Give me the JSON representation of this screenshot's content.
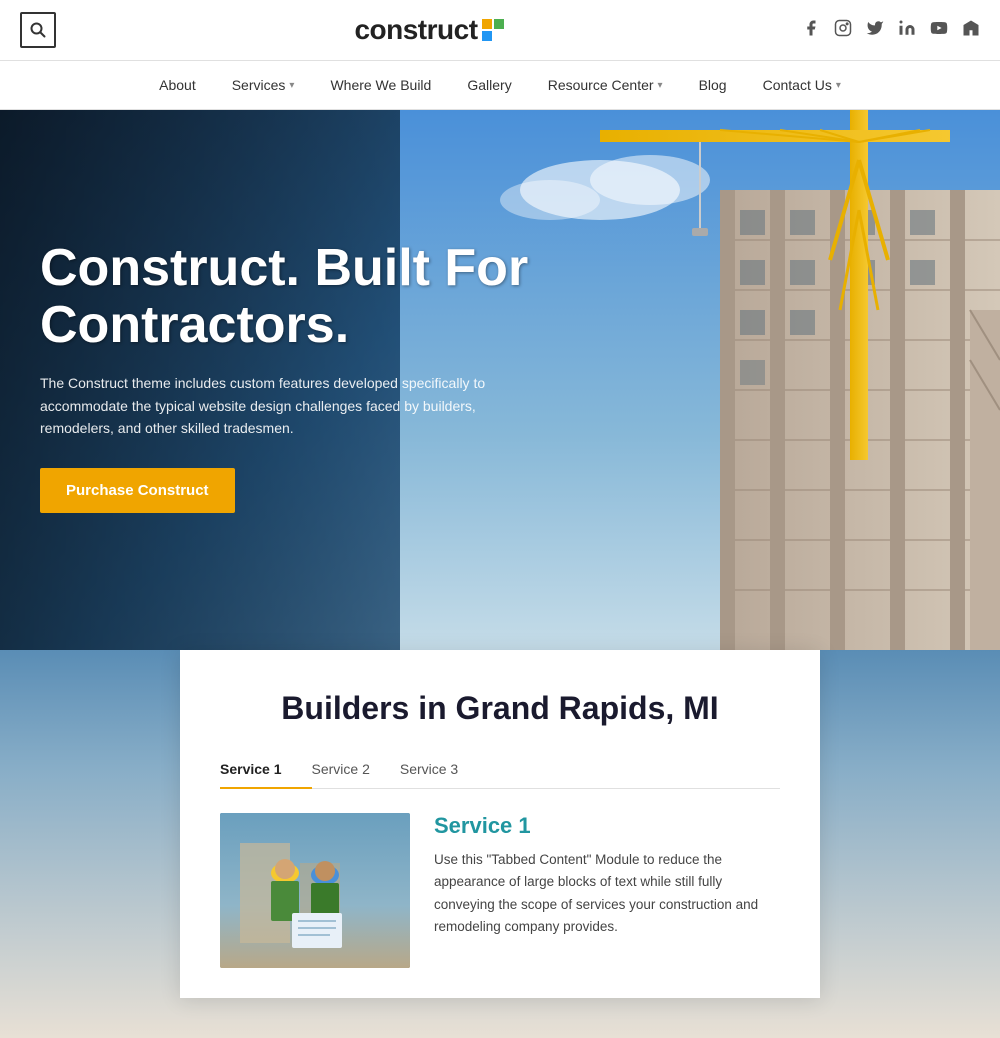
{
  "topbar": {
    "logo_text": "construct",
    "search_label": "search"
  },
  "social": [
    {
      "name": "facebook",
      "icon": "f"
    },
    {
      "name": "instagram",
      "icon": "◻"
    },
    {
      "name": "twitter",
      "icon": "t"
    },
    {
      "name": "linkedin",
      "icon": "in"
    },
    {
      "name": "youtube",
      "icon": "▶"
    },
    {
      "name": "houzz",
      "icon": "h"
    }
  ],
  "nav": {
    "items": [
      {
        "label": "About",
        "has_dropdown": false
      },
      {
        "label": "Services",
        "has_dropdown": true
      },
      {
        "label": "Where We Build",
        "has_dropdown": false
      },
      {
        "label": "Gallery",
        "has_dropdown": false
      },
      {
        "label": "Resource Center",
        "has_dropdown": true
      },
      {
        "label": "Blog",
        "has_dropdown": false
      },
      {
        "label": "Contact Us",
        "has_dropdown": true
      }
    ]
  },
  "hero": {
    "title": "Construct. Built For Contractors.",
    "subtitle": "The Construct theme includes custom features developed specifically to accommodate the typical website design challenges faced by builders, remodelers, and other skilled tradesmen.",
    "cta_label": "Purchase Construct"
  },
  "services": {
    "section_title": "Builders in Grand Rapids, MI",
    "tabs": [
      {
        "label": "Service 1",
        "active": true
      },
      {
        "label": "Service 2",
        "active": false
      },
      {
        "label": "Service 3",
        "active": false
      }
    ],
    "active_service": {
      "name": "Service 1",
      "description": "Use this \"Tabbed Content\" Module to reduce the appearance of large blocks of text while still fully conveying the scope of services your construction and remodeling company provides."
    }
  }
}
